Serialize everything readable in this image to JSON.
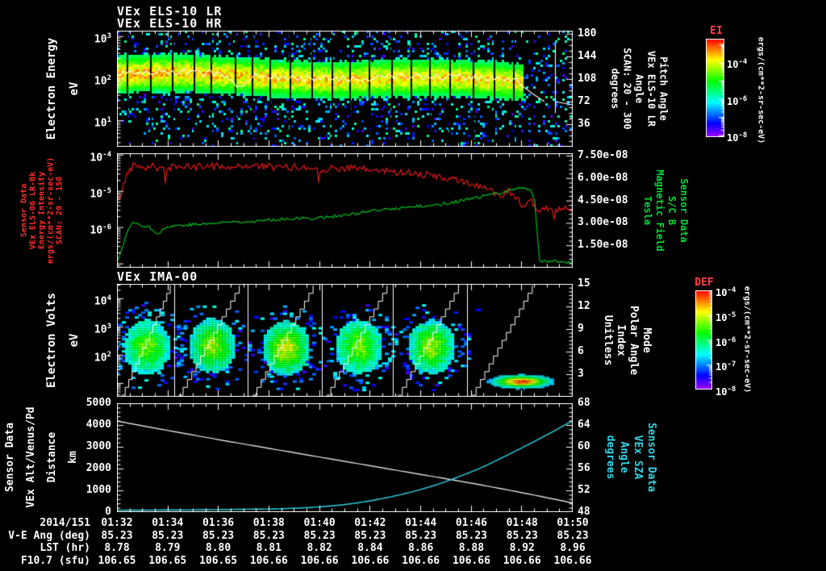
{
  "titles": {
    "panel1_line1": "VEx ELS-10 LR",
    "panel1_line2": "VEx ELS-10 HR",
    "panel3": "VEx IMA-00"
  },
  "colors": {
    "background": "#000000",
    "frame": "#ffffff",
    "red_label": "#ff3030",
    "green_label": "#00dd33",
    "cyan_label": "#30d5e8",
    "colorbar_label_red": "#ff4040",
    "red_series": "#ff1a1a",
    "green_series": "#00cc22",
    "white_series": "#ffffff",
    "cyan_series": "#30d5e8"
  },
  "table": {
    "rows": [
      {
        "label": "2014/151",
        "values": [
          "01:32",
          "01:34",
          "01:36",
          "01:38",
          "01:40",
          "01:42",
          "01:44",
          "01:46",
          "01:48",
          "01:50"
        ]
      },
      {
        "label": "V-E Ang (deg)",
        "values": [
          "85.23",
          "85.23",
          "85.23",
          "85.23",
          "85.23",
          "85.23",
          "85.23",
          "85.23",
          "85.23",
          "85.23"
        ]
      },
      {
        "label": "LST (hr)",
        "values": [
          "8.78",
          "8.79",
          "8.80",
          "8.81",
          "8.82",
          "8.84",
          "8.86",
          "8.88",
          "8.92",
          "8.96"
        ]
      },
      {
        "label": "F10.7 (sfu)",
        "values": [
          "106.65",
          "106.65",
          "106.65",
          "106.66",
          "106.66",
          "106.66",
          "106.66",
          "106.66",
          "106.66",
          "106.66"
        ]
      }
    ]
  },
  "chart_data": [
    {
      "type": "heatmap",
      "name": "els_electron_energy_spectrogram",
      "title": "VEx ELS-10 LR / VEx ELS-10 HR",
      "xlim": [
        "01:32",
        "01:50"
      ],
      "left_axis": {
        "label_lines": [
          "Electron Energy",
          "eV"
        ],
        "scale": "log",
        "lim_log10": [
          0.37,
          3.13
        ],
        "tick_exponents": [
          3,
          2,
          1
        ]
      },
      "right_axis": {
        "label_lines": [
          "Pitch Angle",
          "VEx ELS-10 LR",
          "Angle",
          "SCAN: 20 - 300",
          "degrees"
        ],
        "lim": [
          0,
          185
        ],
        "ticks": [
          180,
          144,
          108,
          72,
          36
        ]
      },
      "colorbar": {
        "label": "EI",
        "units": "ergs/(cm**2-sr-sec-eV)",
        "tick_exponents": [
          -4,
          -6,
          -8
        ]
      },
      "band": {
        "center_log10_ev_start": 2.12,
        "center_log10_ev_end": 1.93,
        "sigma_log10": 0.38,
        "fade_start_frac": 0.89
      }
    },
    {
      "type": "line",
      "name": "energy_intensity_and_magnetic_field",
      "xlim": [
        "01:32",
        "01:50"
      ],
      "left_axis": {
        "label_lines": [
          "Sensor Data",
          "VEx ELS-06 LR-Bk",
          "Energy Intensity",
          "ergs/(cm**2-sr-sec-eV)",
          "SCAN: 20 - 150"
        ],
        "scale": "log",
        "lim_log10": [
          -7.12,
          -3.96
        ],
        "tick_exponents": [
          -4,
          -5,
          -6
        ]
      },
      "right_axis": {
        "label_lines": [
          "Sensor Data",
          "S/C B",
          "Magnetic Field",
          "Tesla"
        ],
        "lim": [
          0,
          7.66e-08
        ],
        "ticks": [
          "7.50e-08",
          "6.00e-08",
          "4.50e-08",
          "3.00e-08",
          "1.50e-08"
        ],
        "tick_values_1e8": [
          7.5,
          6,
          4.5,
          3,
          1.5
        ]
      },
      "series": [
        {
          "name": "energy_intensity",
          "axis": "left",
          "units": "log10 ergs/(cm**2-sr-sec-eV)",
          "points": [
            [
              0,
              -5.35
            ],
            [
              0.2,
              -5.0
            ],
            [
              0.4,
              -4.5
            ],
            [
              0.7,
              -4.25
            ],
            [
              1.1,
              -4.35
            ],
            [
              1.4,
              -4.28
            ],
            [
              1.8,
              -4.45
            ],
            [
              2.3,
              -4.3
            ],
            [
              2.9,
              -4.36
            ],
            [
              3.6,
              -4.3
            ],
            [
              4.5,
              -4.34
            ],
            [
              5.4,
              -4.3
            ],
            [
              6.3,
              -4.36
            ],
            [
              7.2,
              -4.34
            ],
            [
              8.1,
              -4.4
            ],
            [
              9,
              -4.36
            ],
            [
              9.9,
              -4.42
            ],
            [
              10.8,
              -4.46
            ],
            [
              11.7,
              -4.5
            ],
            [
              12.6,
              -4.6
            ],
            [
              13.3,
              -4.7
            ],
            [
              14,
              -4.8
            ],
            [
              14.6,
              -4.95
            ],
            [
              15.1,
              -5.1
            ],
            [
              15.5,
              -5.0
            ],
            [
              15.8,
              -5.2
            ],
            [
              16.1,
              -5.45
            ],
            [
              16.4,
              -5.3
            ],
            [
              16.6,
              -5.6
            ],
            [
              16.9,
              -5.45
            ],
            [
              17.3,
              -5.55
            ],
            [
              17.6,
              -5.5
            ],
            [
              18,
              -5.55
            ]
          ]
        },
        {
          "name": "magnetic_field",
          "axis": "right",
          "units": "1e-8 Tesla",
          "points": [
            [
              0,
              0.45
            ],
            [
              0.1,
              0.8
            ],
            [
              0.3,
              1.8
            ],
            [
              0.55,
              3.0
            ],
            [
              0.9,
              2.9
            ],
            [
              1.3,
              2.7
            ],
            [
              1.6,
              2.3
            ],
            [
              2,
              2.75
            ],
            [
              2.5,
              2.85
            ],
            [
              3.2,
              2.9
            ],
            [
              4,
              3.0
            ],
            [
              4.7,
              3.1
            ],
            [
              5.4,
              3.1
            ],
            [
              6.1,
              3.2
            ],
            [
              6.8,
              3.3
            ],
            [
              7.6,
              3.3
            ],
            [
              8.3,
              3.4
            ],
            [
              9,
              3.5
            ],
            [
              9.7,
              3.7
            ],
            [
              10.4,
              3.85
            ],
            [
              11.2,
              4.0
            ],
            [
              11.9,
              4.1
            ],
            [
              12.6,
              4.2
            ],
            [
              13.3,
              4.4
            ],
            [
              14,
              4.6
            ],
            [
              14.8,
              4.9
            ],
            [
              15.3,
              5.1
            ],
            [
              15.8,
              5.3
            ],
            [
              16.2,
              5.35
            ],
            [
              16.35,
              5.2
            ],
            [
              16.5,
              4.5
            ],
            [
              16.6,
              2.2
            ],
            [
              16.7,
              0.5
            ],
            [
              16.8,
              0.3
            ],
            [
              16.9,
              0.45
            ],
            [
              17,
              0.3
            ],
            [
              17.2,
              0.5
            ],
            [
              17.4,
              0.3
            ],
            [
              17.6,
              0.45
            ],
            [
              17.8,
              0.35
            ],
            [
              18,
              0.4
            ]
          ]
        }
      ]
    },
    {
      "type": "heatmap",
      "name": "ima_ion_spectrogram",
      "title": "VEx IMA-00",
      "xlim": [
        "01:32",
        "01:50"
      ],
      "left_axis": {
        "label_lines": [
          "Electron Volts",
          "eV"
        ],
        "scale": "log",
        "lim_log10": [
          0.51,
          4.51
        ],
        "tick_exponents": [
          4,
          3,
          2
        ]
      },
      "right_axis": {
        "label_lines": [
          "Mode",
          "Polar Angle",
          "Index",
          "Unitless"
        ],
        "lim": [
          0,
          15
        ],
        "ticks": [
          15,
          12,
          9,
          6,
          3
        ]
      },
      "colorbar": {
        "label": "DEF",
        "units": "ergs/(cm**2-sr-sec-eV)",
        "tick_exponents": [
          -4,
          -5,
          -6,
          -7,
          -8
        ]
      },
      "segment_boundaries_frac": [
        0,
        0.125,
        0.287,
        0.449,
        0.606,
        0.768,
        1.0
      ],
      "blobs": [
        {
          "segment": 0,
          "cy_frac": 0.55,
          "intensity": 0.6
        },
        {
          "segment": 1,
          "cy_frac": 0.54,
          "intensity": 0.66
        },
        {
          "segment": 2,
          "cy_frac": 0.56,
          "intensity": 0.75
        },
        {
          "segment": 3,
          "cy_frac": 0.55,
          "intensity": 0.62
        },
        {
          "segment": 4,
          "cy_frac": 0.55,
          "intensity": 0.66
        },
        {
          "segment": 5,
          "kind": "streak",
          "cx_frac": 0.885,
          "cy_frac": 0.86,
          "intensity": 0.97
        }
      ],
      "stray_dashes_frac": [
        [
          0.787,
          0.22
        ],
        [
          0.3,
          0.285
        ],
        [
          0.49,
          0.235
        ],
        [
          0.63,
          0.3
        ]
      ]
    },
    {
      "type": "line",
      "name": "altitude_and_sza",
      "xlim": [
        "01:32",
        "01:50"
      ],
      "left_axis": {
        "label_lines": [
          "Sensor Data",
          "VEx Alt/Venus/Pd",
          "Distance",
          "km"
        ],
        "lim": [
          0,
          5000
        ],
        "ticks": [
          5000,
          4000,
          3000,
          2000,
          1000,
          0
        ]
      },
      "right_axis": {
        "label_lines": [
          "Sensor Data",
          "VEx SZA",
          "Angle",
          "degrees"
        ],
        "lim": [
          48,
          68
        ],
        "ticks": [
          68,
          64,
          60,
          56,
          52,
          48
        ]
      },
      "series": [
        {
          "name": "altitude_km",
          "axis": "left",
          "units": "km",
          "points": [
            [
              0,
              4180
            ],
            [
              2.25,
              3700
            ],
            [
              4.5,
              3230
            ],
            [
              6.75,
              2780
            ],
            [
              9,
              2330
            ],
            [
              11.25,
              1880
            ],
            [
              13.5,
              1430
            ],
            [
              15.75,
              950
            ],
            [
              18,
              420
            ]
          ]
        },
        {
          "name": "sza_deg",
          "axis": "right",
          "units": "degrees",
          "points": [
            [
              0,
              48.35
            ],
            [
              1.8,
              48.4
            ],
            [
              3.6,
              48.45
            ],
            [
              5.4,
              48.55
            ],
            [
              6.3,
              48.6
            ],
            [
              7.2,
              48.75
            ],
            [
              8.1,
              49.0
            ],
            [
              9,
              49.4
            ],
            [
              9.9,
              50.0
            ],
            [
              10.8,
              50.8
            ],
            [
              11.7,
              51.8
            ],
            [
              12.6,
              53.0
            ],
            [
              13.5,
              54.5
            ],
            [
              14.4,
              56.2
            ],
            [
              15.3,
              58.2
            ],
            [
              16.2,
              60.3
            ],
            [
              17.1,
              62.5
            ],
            [
              18,
              64.8
            ]
          ]
        }
      ]
    }
  ]
}
